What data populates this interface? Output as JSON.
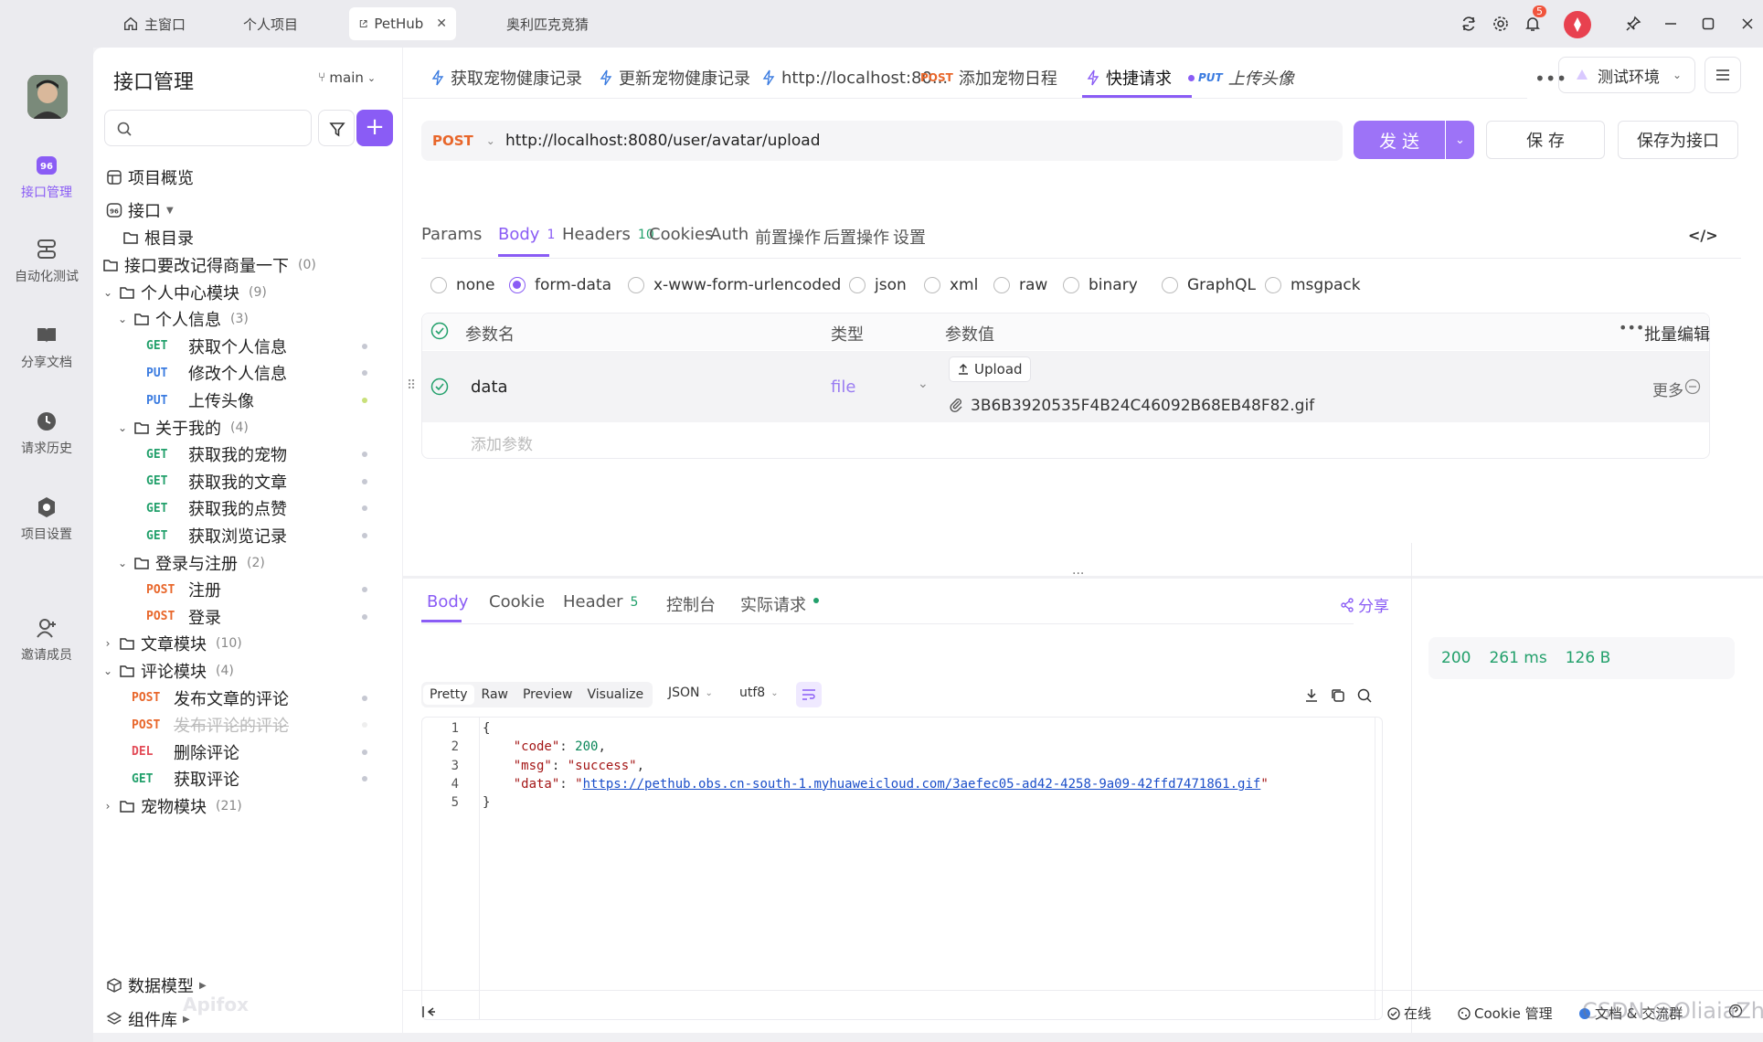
{
  "window_tabs": [
    {
      "label": "主窗口",
      "icon": "home-icon"
    },
    {
      "label": "个人项目"
    },
    {
      "label": "PetHub",
      "icon": "external-link-icon",
      "active": true
    },
    {
      "label": "奥利匹克竞猜"
    }
  ],
  "notification_count": "5",
  "rail": [
    {
      "label": "接口管理",
      "icon": "api-icon",
      "active": true
    },
    {
      "label": "自动化测试",
      "icon": "automation-icon"
    },
    {
      "label": "分享文档",
      "icon": "book-icon"
    },
    {
      "label": "请求历史",
      "icon": "history-icon"
    },
    {
      "label": "项目设置",
      "icon": "settings-icon"
    },
    {
      "label": "邀请成员",
      "icon": "invite-user-icon"
    }
  ],
  "tree": {
    "title": "接口管理",
    "branch": "main",
    "overview": "项目概览",
    "interfaces": "接口",
    "root": "根目录",
    "rows": [
      {
        "type": "folder",
        "label": "接口要改记得商量一下",
        "count": "(0)"
      },
      {
        "type": "folder",
        "label": "个人中心模块",
        "count": "(9)",
        "open": true
      },
      {
        "type": "folder",
        "label": "个人信息",
        "count": "(3)",
        "open": true
      },
      {
        "type": "api",
        "method": "GET",
        "label": "获取个人信息"
      },
      {
        "type": "api",
        "method": "PUT",
        "label": "修改个人信息"
      },
      {
        "type": "api",
        "method": "PUT",
        "label": "上传头像",
        "dot_color": "#c9e07a"
      },
      {
        "type": "folder",
        "label": "关于我的",
        "count": "(4)",
        "open": true
      },
      {
        "type": "api",
        "method": "GET",
        "label": "获取我的宠物"
      },
      {
        "type": "api",
        "method": "GET",
        "label": "获取我的文章"
      },
      {
        "type": "api",
        "method": "GET",
        "label": "获取我的点赞"
      },
      {
        "type": "api",
        "method": "GET",
        "label": "获取浏览记录"
      },
      {
        "type": "folder",
        "label": "登录与注册",
        "count": "(2)",
        "open": true
      },
      {
        "type": "api",
        "method": "POST",
        "label": "注册"
      },
      {
        "type": "api",
        "method": "POST",
        "label": "登录"
      },
      {
        "type": "folder",
        "label": "文章模块",
        "count": "(10)"
      },
      {
        "type": "folder",
        "label": "评论模块",
        "count": "(4)",
        "open": true
      },
      {
        "type": "api",
        "method": "POST",
        "label": "发布文章的评论"
      },
      {
        "type": "api",
        "method": "POST",
        "label": "发布评论的评论",
        "deprecated": true
      },
      {
        "type": "api",
        "method": "DEL",
        "label": "删除评论"
      },
      {
        "type": "api",
        "method": "GET",
        "label": "获取评论"
      },
      {
        "type": "folder",
        "label": "宠物模块",
        "count": "(21)"
      }
    ],
    "data_models": "数据模型",
    "components": "组件库",
    "watermark": "Apifox"
  },
  "request_tabs": [
    {
      "label": "获取宠物健康记录",
      "icon": "lightning-icon"
    },
    {
      "label": "更新宠物健康记录",
      "icon": "lightning-icon"
    },
    {
      "label": "http://localhost:80...",
      "icon": "lightning-icon"
    },
    {
      "label": "添加宠物日程",
      "method": "POST"
    },
    {
      "label": "快捷请求",
      "icon": "lightning-icon",
      "active": true
    },
    {
      "label": "上传头像",
      "method": "PUT"
    }
  ],
  "environment": "测试环境",
  "request": {
    "method": "POST",
    "url": "http://localhost:8080/user/avatar/upload",
    "send": "发 送",
    "save": "保 存",
    "save_as": "保存为接口"
  },
  "param_tabs": [
    {
      "label": "Params"
    },
    {
      "label": "Body",
      "badge": "1",
      "active": true
    },
    {
      "label": "Headers",
      "badge": "10"
    },
    {
      "label": "Cookies"
    },
    {
      "label": "Auth"
    },
    {
      "label": "前置操作"
    },
    {
      "label": "后置操作"
    },
    {
      "label": "设置"
    }
  ],
  "body_types": [
    {
      "label": "none"
    },
    {
      "label": "form-data",
      "selected": true
    },
    {
      "label": "x-www-form-urlencoded"
    },
    {
      "label": "json"
    },
    {
      "label": "xml"
    },
    {
      "label": "raw"
    },
    {
      "label": "binary"
    },
    {
      "label": "GraphQL"
    },
    {
      "label": "msgpack"
    }
  ],
  "form_table": {
    "headers": {
      "name": "参数名",
      "type": "类型",
      "value": "参数值",
      "bulk_edit": "批量编辑"
    },
    "row": {
      "name": "data",
      "type": "file",
      "upload": "Upload",
      "file_name": "3B6B3920535F4B24C46092B68EB48F82.gif",
      "more": "更多"
    },
    "add_placeholder": "添加参数"
  },
  "response_tabs": [
    {
      "label": "Body",
      "active": true
    },
    {
      "label": "Cookie"
    },
    {
      "label": "Header",
      "badge": "5"
    },
    {
      "label": "控制台"
    },
    {
      "label": "实际请求"
    }
  ],
  "share": "分享",
  "view_tabs": [
    "Pretty",
    "Raw",
    "Preview",
    "Visualize"
  ],
  "format": "JSON",
  "encoding": "utf8",
  "code_lines": [
    {
      "n": "1"
    },
    {
      "n": "2",
      "key": "\"code\"",
      "value": "200"
    },
    {
      "n": "3",
      "key": "\"msg\"",
      "value": "\"success\""
    },
    {
      "n": "4",
      "key": "\"data\"",
      "value": "https://pethub.obs.cn-south-1.myhuaweicloud.com/3aefec05-ad42-4258-9a09-42ffd7471861.gif"
    },
    {
      "n": "5"
    }
  ],
  "status": {
    "code": "200",
    "time": "261 ms",
    "size": "126 B"
  },
  "footer": {
    "online": "在线",
    "cookie": "Cookie 管理",
    "docs": "文档 & 交流群",
    "watermark": "CSDN @OliaiaZhu"
  },
  "colors": {
    "accent": "#8a5cf5",
    "success": "#22a06b",
    "status": "#22a06b"
  }
}
